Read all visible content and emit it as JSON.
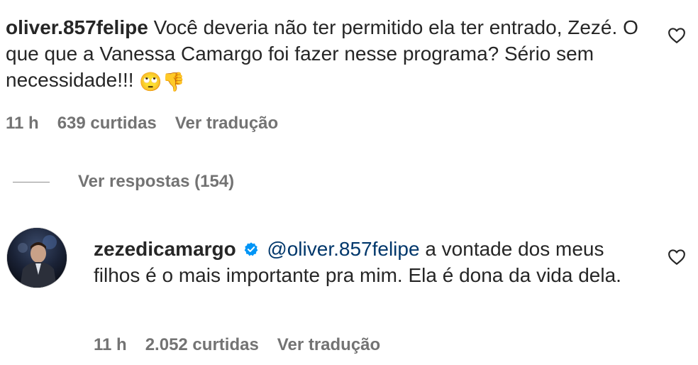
{
  "comments": [
    {
      "username": "oliver.857felipe",
      "text": "Você deveria não ter permitido ela ter entrado, Zezé. O que que a Vanessa Camargo foi fazer nesse programa? Sério sem necessidade!!!",
      "emojis": [
        "🙄",
        "👎"
      ],
      "time": "11 h",
      "likes": "639 curtidas",
      "translate": "Ver tradução",
      "like_icon": "heart-outline-icon"
    },
    {
      "username": "zezedicamargo",
      "verified_icon": "verified-badge-icon",
      "mention": "@oliver.857felipe",
      "text": "a vontade dos meus filhos é o mais importante pra mim. Ela é dona da vida dela.",
      "time": "11 h",
      "likes": "2.052 curtidas",
      "translate": "Ver tradução",
      "like_icon": "heart-outline-icon"
    }
  ],
  "replies": {
    "label": "Ver respostas (154)"
  },
  "colors": {
    "text": "#262626",
    "secondary": "#737373",
    "mention": "#00376b",
    "verified": "#0095f6"
  }
}
